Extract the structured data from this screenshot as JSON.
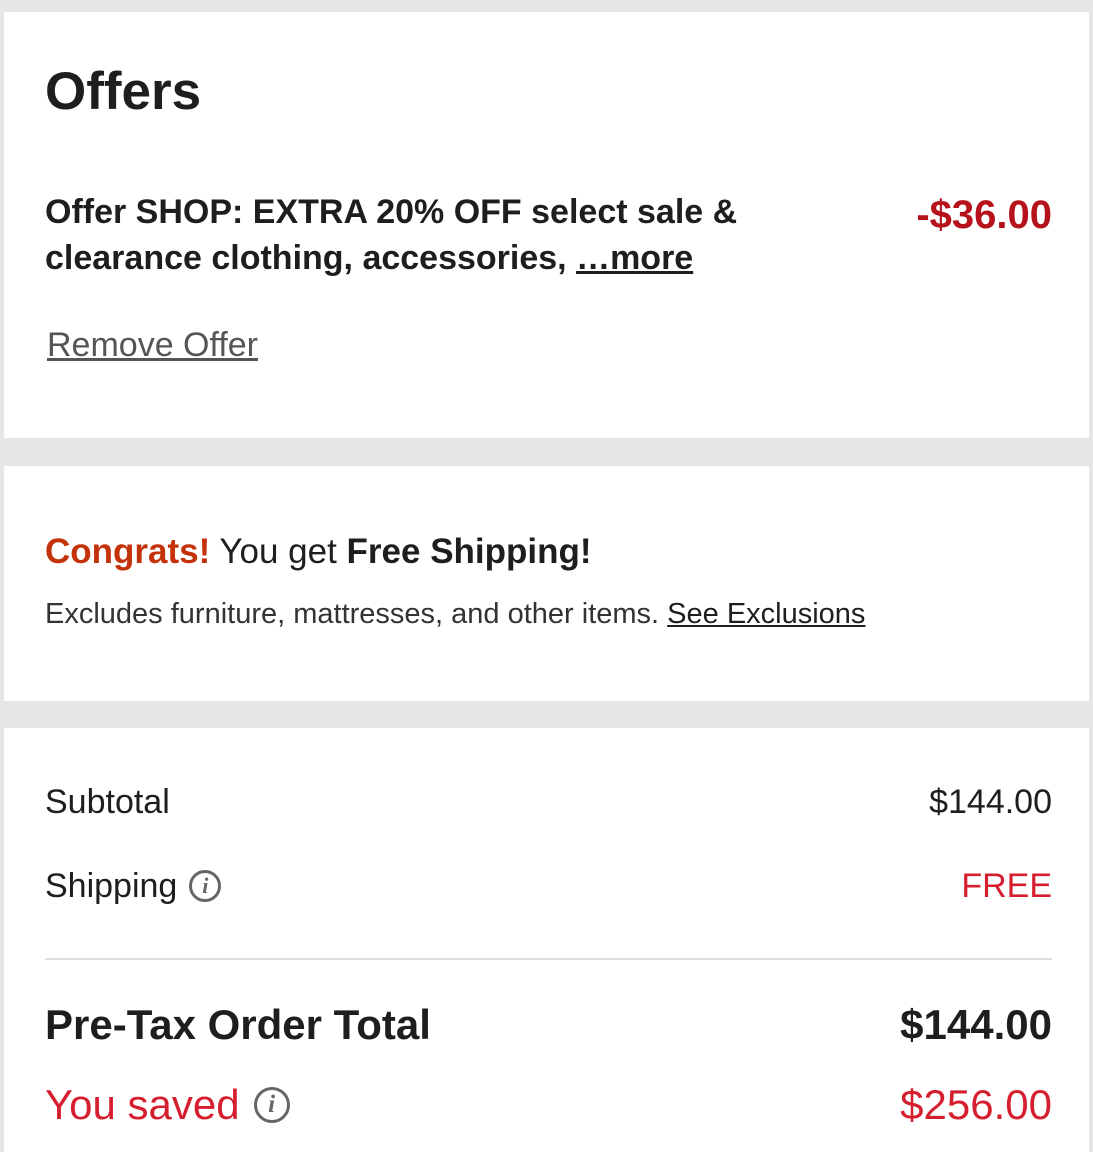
{
  "offers": {
    "title": "Offers",
    "offer_text": "Offer SHOP: EXTRA 20% OFF select sale & clearance clothing, accessories,",
    "more_link": "…more",
    "amount": "-$36.00",
    "remove_label": "Remove Offer"
  },
  "shipping": {
    "congrats": "Congrats!",
    "you_get": " You get ",
    "free_shipping": "Free Shipping!",
    "excludes_text": "Excludes furniture, mattresses, and other items. ",
    "see_exclusions": "See Exclusions"
  },
  "summary": {
    "subtotal_label": "Subtotal",
    "subtotal_value": "$144.00",
    "shipping_label": "Shipping",
    "shipping_value": "FREE",
    "total_label": "Pre-Tax Order Total",
    "total_value": "$144.00",
    "saved_label": "You saved",
    "saved_value": "$256.00",
    "info_glyph": "i"
  },
  "icons": {
    "shipping_info": "info-icon",
    "saved_info": "info-icon"
  },
  "colors": {
    "accent_red": "#d51f2f",
    "offer_red": "#b5121b",
    "congrats_orange": "#c4320a",
    "page_bg": "#e6e6e6"
  }
}
